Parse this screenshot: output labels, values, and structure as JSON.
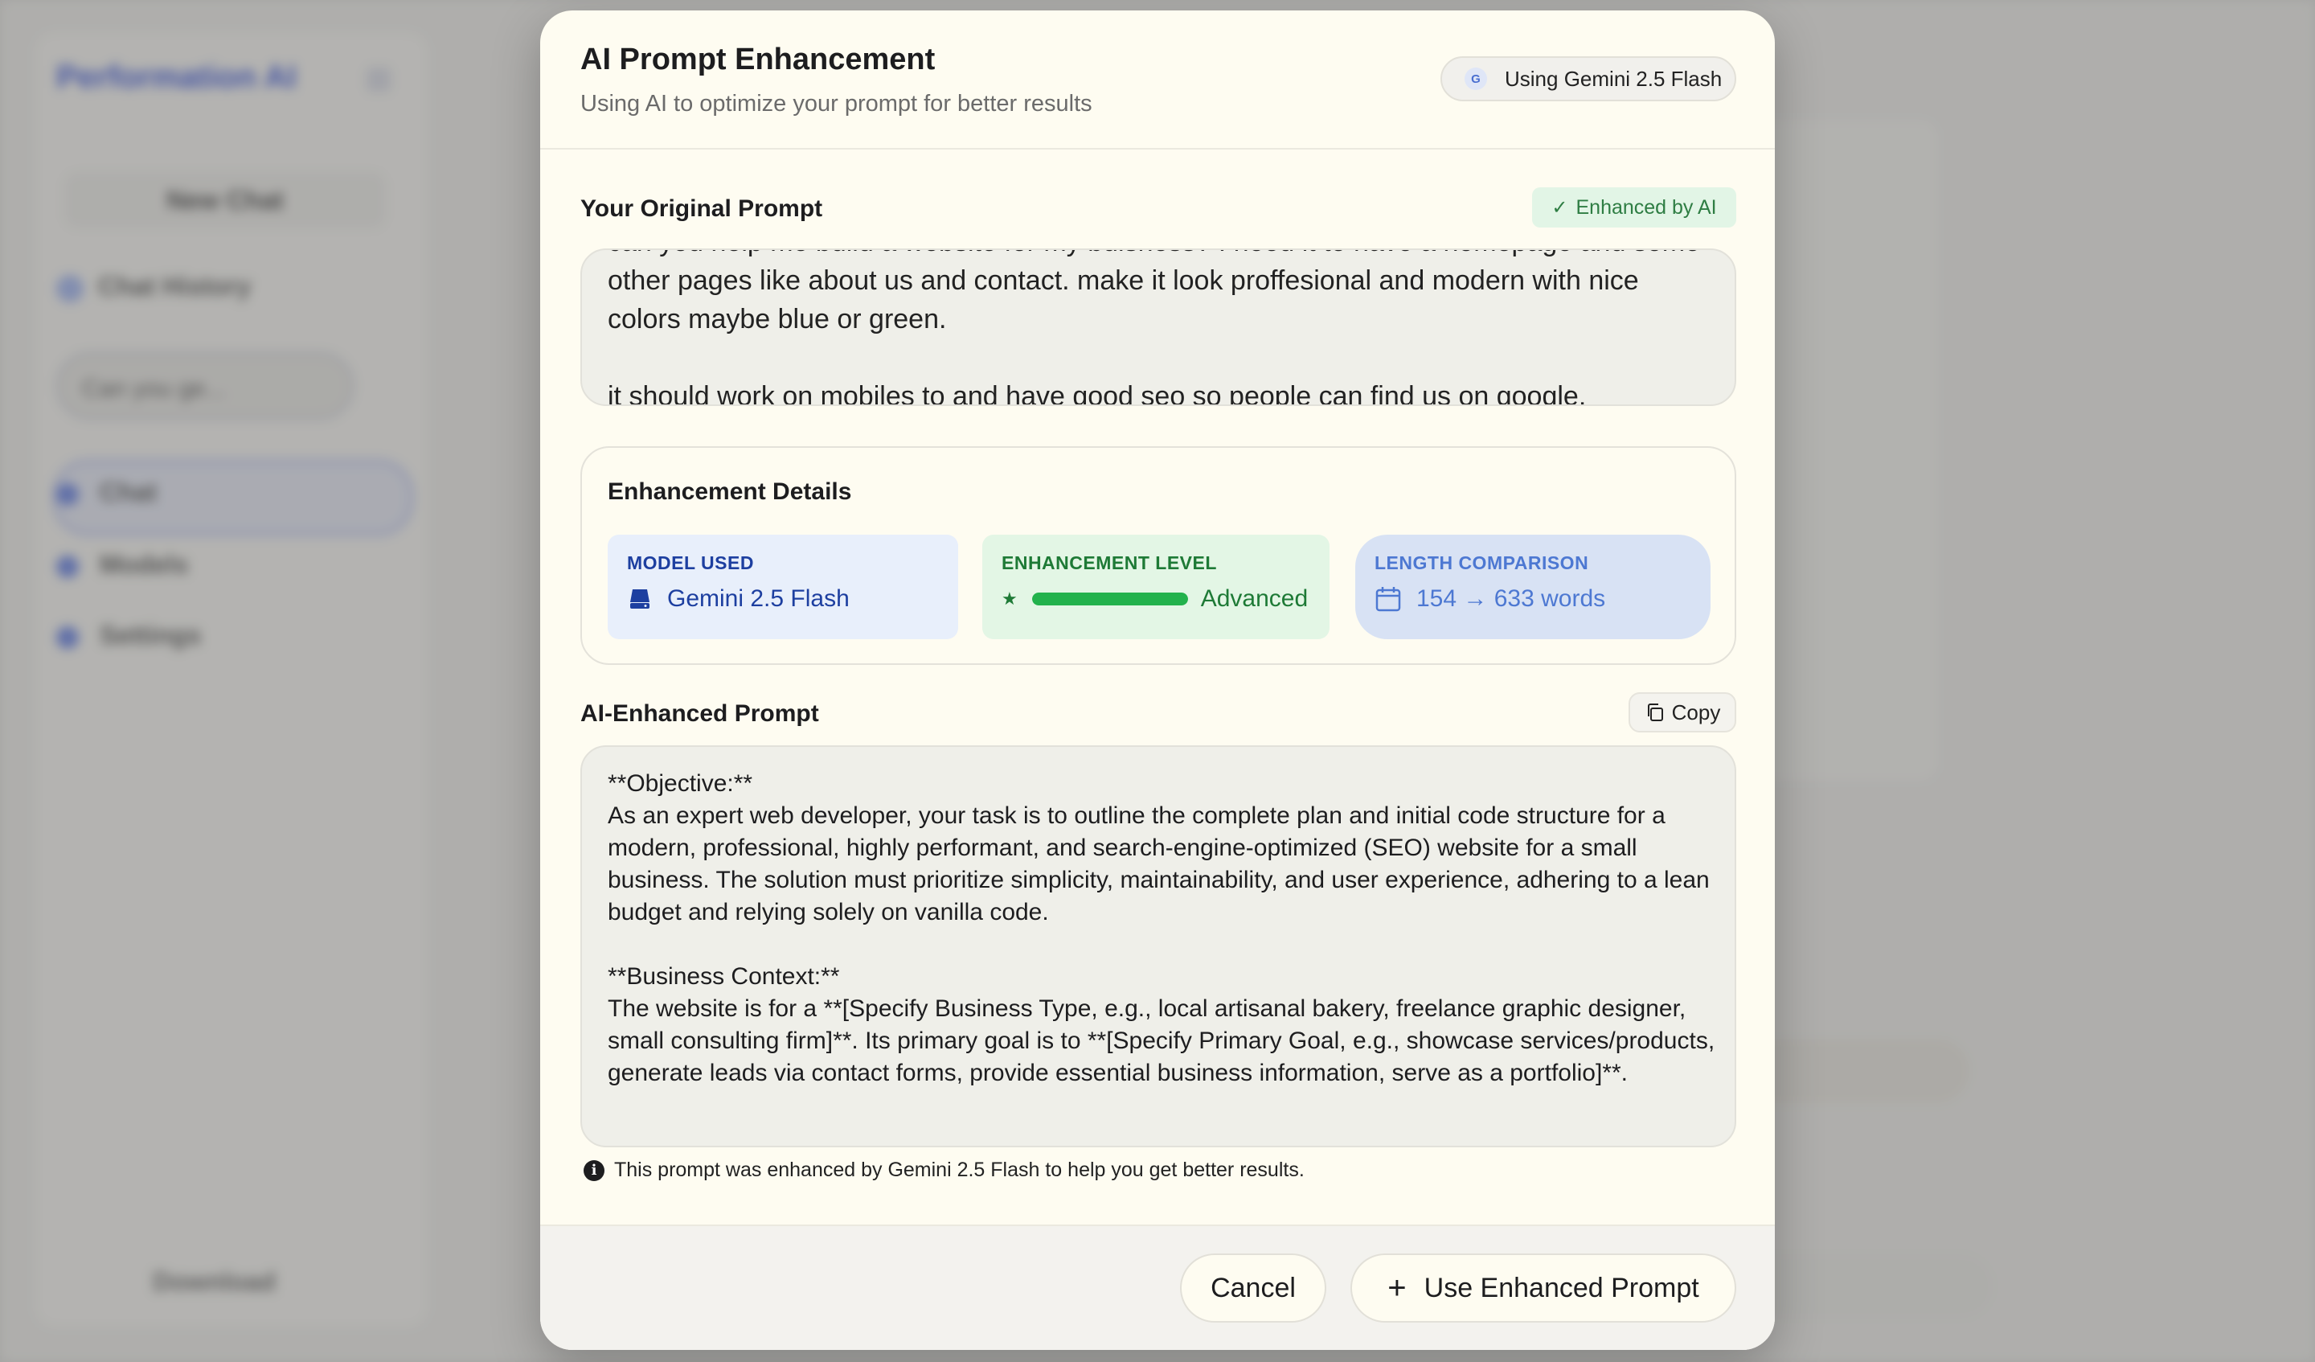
{
  "background": {
    "brand": "Performation AI",
    "new_chat": "New Chat",
    "chat_history": "Chat History",
    "history_item": "Can you ge...",
    "nav": [
      "Chat",
      "Models",
      "Settings"
    ],
    "download": "Download"
  },
  "modal": {
    "title": "AI Prompt Enhancement",
    "subtitle": "Using AI to optimize your prompt for better results",
    "model_badge": "Using Gemini 2.5 Flash",
    "model_badge_icon": "G",
    "original": {
      "label": "Your Original Prompt",
      "badge": "Enhanced by AI",
      "text": "can you help me build a website for my buisness? I need it to have a homepage and some other pages like about us and contact. make it look proffesional and modern with nice colors maybe blue or green.\n\nit should work on mobiles to and have good seo so people can find us on google."
    },
    "details": {
      "title": "Enhancement Details",
      "model_used_label": "MODEL USED",
      "model_used_value": "Gemini 2.5 Flash",
      "level_label": "ENHANCEMENT LEVEL",
      "level_value": "Advanced",
      "level_progress": 1.0,
      "length_label": "LENGTH COMPARISON",
      "length_value": "154 → 633 words"
    },
    "enhanced": {
      "label": "AI-Enhanced Prompt",
      "copy_label": "Copy",
      "text": "**Objective:**\nAs an expert web developer, your task is to outline the complete plan and initial code structure for a modern, professional, highly performant, and search-engine-optimized (SEO) website for a small business. The solution must prioritize simplicity, maintainability, and user experience, adhering to a lean budget and relying solely on vanilla code.\n\n**Business Context:**\nThe website is for a **[Specify Business Type, e.g., local artisanal bakery, freelance graphic designer, small consulting firm]**. Its primary goal is to **[Specify Primary Goal, e.g., showcase services/products, generate leads via contact forms, provide essential business information, serve as a portfolio]**."
    },
    "info_text": "This prompt was enhanced by Gemini 2.5 Flash to help you get better results.",
    "cancel_label": "Cancel",
    "use_label": "Use Enhanced Prompt"
  },
  "colors": {
    "accent_blue": "#1d3fa0",
    "accent_green": "#22b24c",
    "modal_bg": "#fefcf1"
  }
}
